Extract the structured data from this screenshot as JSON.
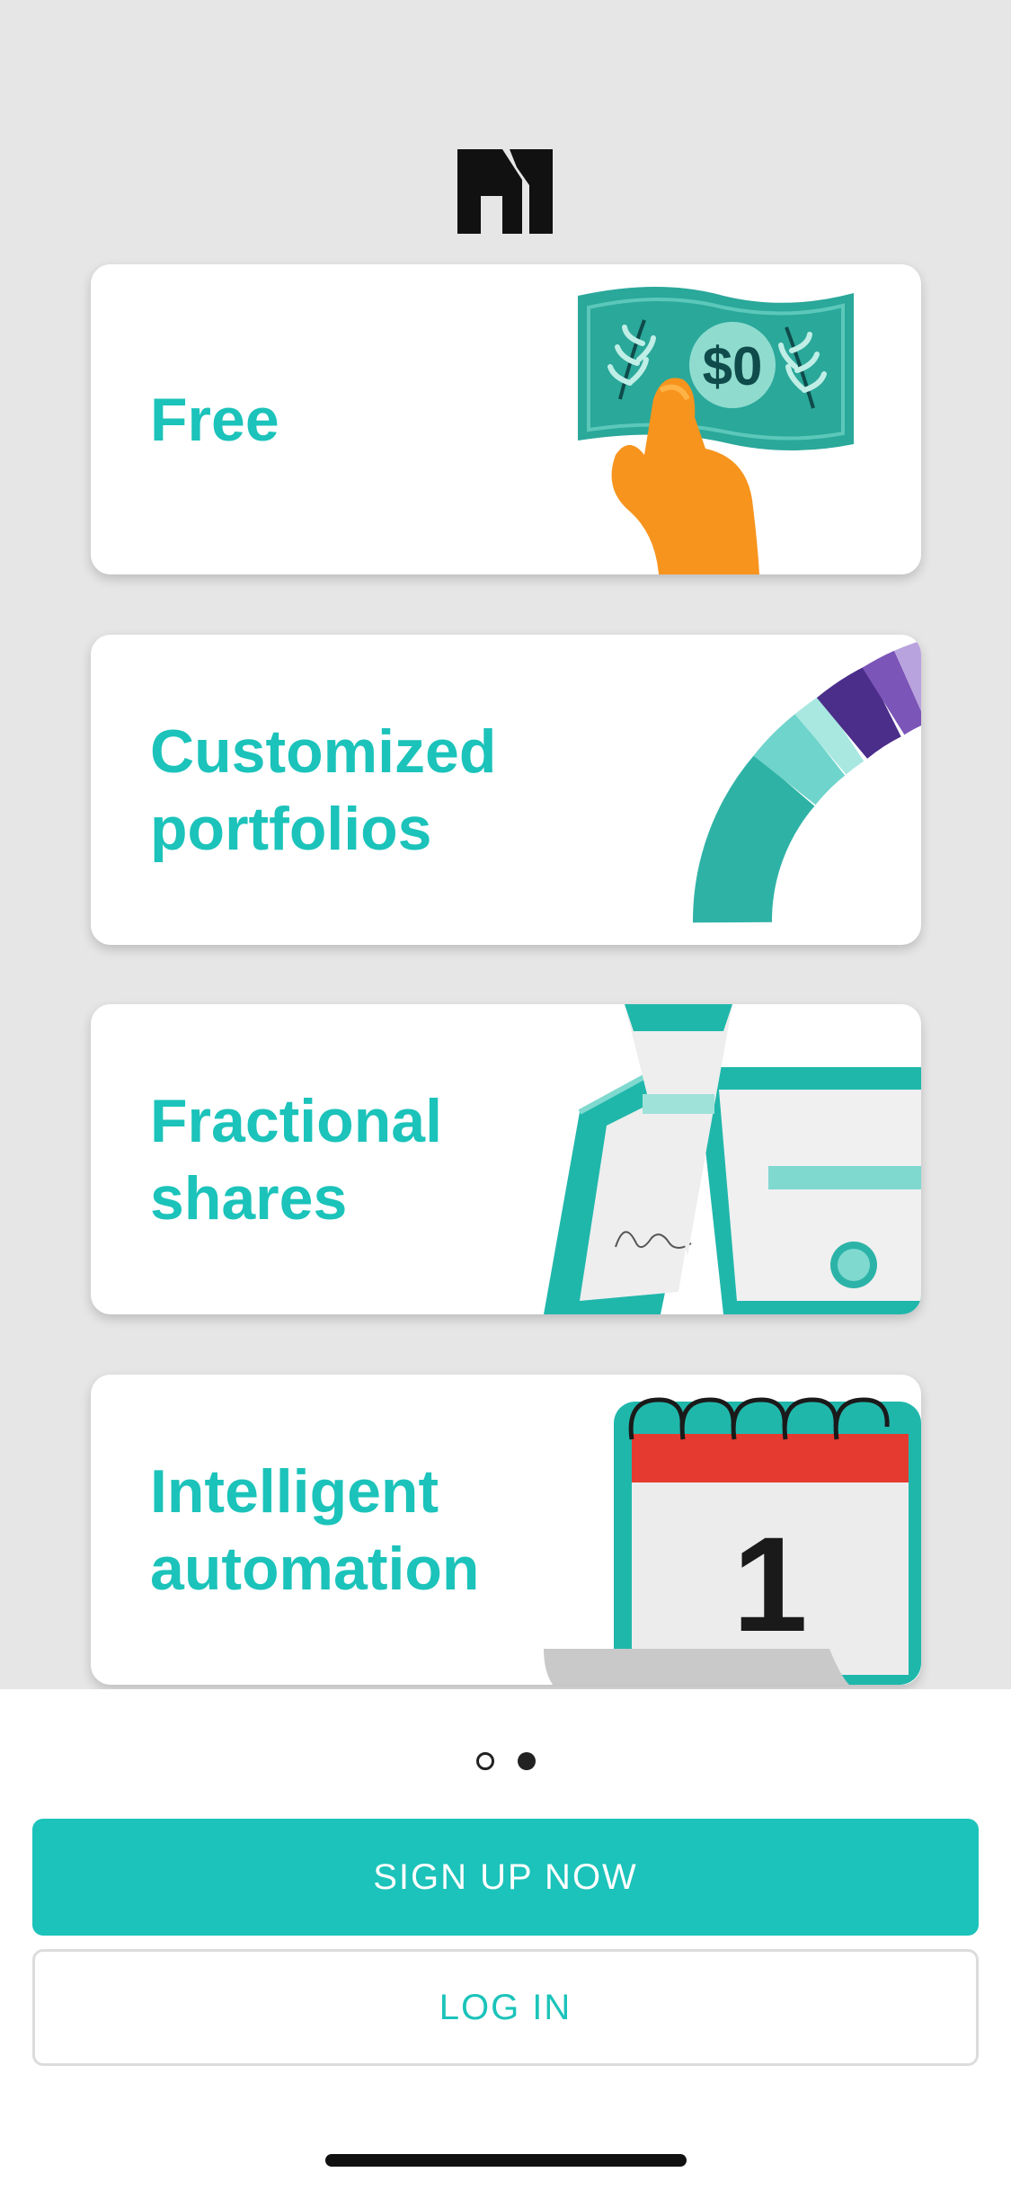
{
  "cards": [
    {
      "title_lines": [
        "Free"
      ],
      "art": "dollar-bill-illustration"
    },
    {
      "title_lines": [
        "Customized",
        "portfolios"
      ],
      "art": "donut-chart-illustration"
    },
    {
      "title_lines": [
        "Fractional",
        "shares"
      ],
      "art": "torn-stock-certificate-illustration"
    },
    {
      "title_lines": [
        "Intelligent",
        "automation"
      ],
      "art": "calendar-illustration"
    }
  ],
  "bill_text": "$0",
  "calendar_day": "1",
  "pagination": {
    "total": 2,
    "active_index": 1
  },
  "buttons": {
    "signup_label": "SIGN UP NOW",
    "login_label": "LOG IN"
  },
  "colors": {
    "brand": "#1bc3ba",
    "background": "#e6e6e6",
    "calendar_red": "#e53a2f",
    "skin": "#f7941d"
  }
}
